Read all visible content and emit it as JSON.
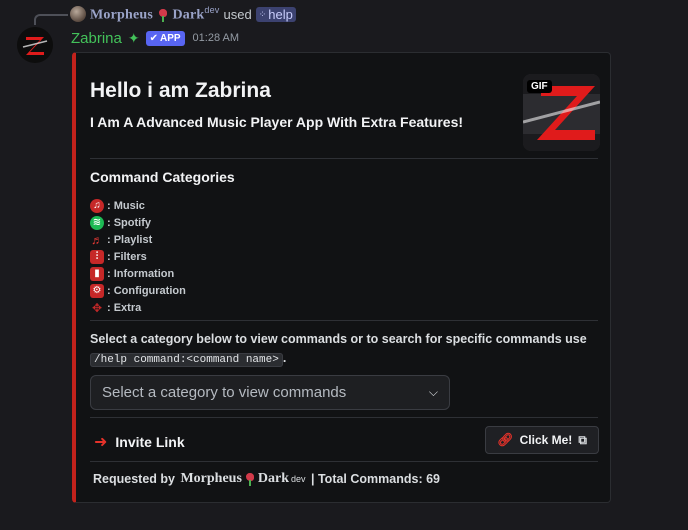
{
  "reply": {
    "user_first": "Morpheus",
    "user_second": "Dark",
    "user_sup": "dev",
    "used": "used",
    "command": "help"
  },
  "message": {
    "bot_name": "Zabrina",
    "app_tag": "APP",
    "time": "01:28 AM"
  },
  "embed": {
    "accent_color": "#c2221c",
    "title": "Hello i am Zabrina",
    "subtitle": "I Am A Advanced Music Player App With Extra Features!",
    "thumbnail_badge": "GIF",
    "categories_heading": "Command Categories",
    "categories": [
      {
        "label": ": Music",
        "icon": "headphones-icon"
      },
      {
        "label": ": Spotify",
        "icon": "spotify-icon"
      },
      {
        "label": ": Playlist",
        "icon": "playlist-icon"
      },
      {
        "label": ": Filters",
        "icon": "filters-icon"
      },
      {
        "label": ": Information",
        "icon": "information-icon"
      },
      {
        "label": ": Configuration",
        "icon": "gear-icon"
      },
      {
        "label": ": Extra",
        "icon": "extra-icon"
      }
    ],
    "select_prompt_before": "Select a category below to view commands or to search for specific commands use ",
    "select_prompt_code": "/help command:<command name>",
    "select_prompt_after": ".",
    "select_placeholder": "Select a category to view commands",
    "invite_label": "Invite Link",
    "click_button": "Click Me!",
    "footer_prefix": "Requested by ",
    "footer_user_first": "Morpheus",
    "footer_user_second": "Dark",
    "footer_user_sup": "dev",
    "footer_suffix": " | Total Commands: 69"
  },
  "colors": {
    "bot_name": "#43c25a",
    "app_tag": "#5865f2",
    "accent_red": "#e5322a"
  }
}
